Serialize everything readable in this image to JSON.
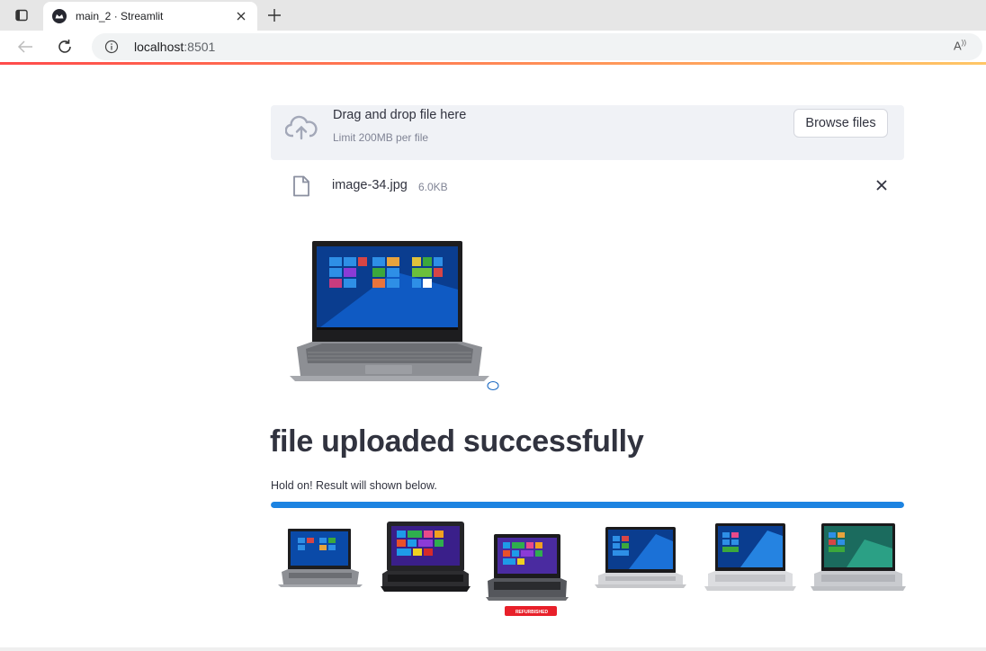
{
  "browser": {
    "tab_title": "main_2 · Streamlit",
    "url_host": "localhost",
    "url_port": ":8501"
  },
  "uploader": {
    "drop_title": "Drag and drop file here",
    "limit_text": "Limit 200MB per file",
    "browse_label": "Browse files",
    "file_name": "image-34.jpg",
    "file_size": "6.0KB"
  },
  "main": {
    "title": "file uploaded successfully",
    "hold_text": "Hold on! Result will shown below.",
    "progress": 1.0
  },
  "results": {
    "count": 6,
    "refurbished_badge": "REFURBISHED"
  },
  "colors": {
    "accent": "#ff4b4b",
    "progress": "#1c83e1",
    "dropzone_bg": "#f0f2f6",
    "text": "#31333f"
  },
  "icons": [
    "sidebar-icon",
    "streamlit-favicon",
    "close-icon",
    "plus-icon",
    "back-icon",
    "reload-icon",
    "info-icon",
    "read-aloud-icon",
    "cloud-upload-icon",
    "file-icon",
    "close-icon"
  ]
}
